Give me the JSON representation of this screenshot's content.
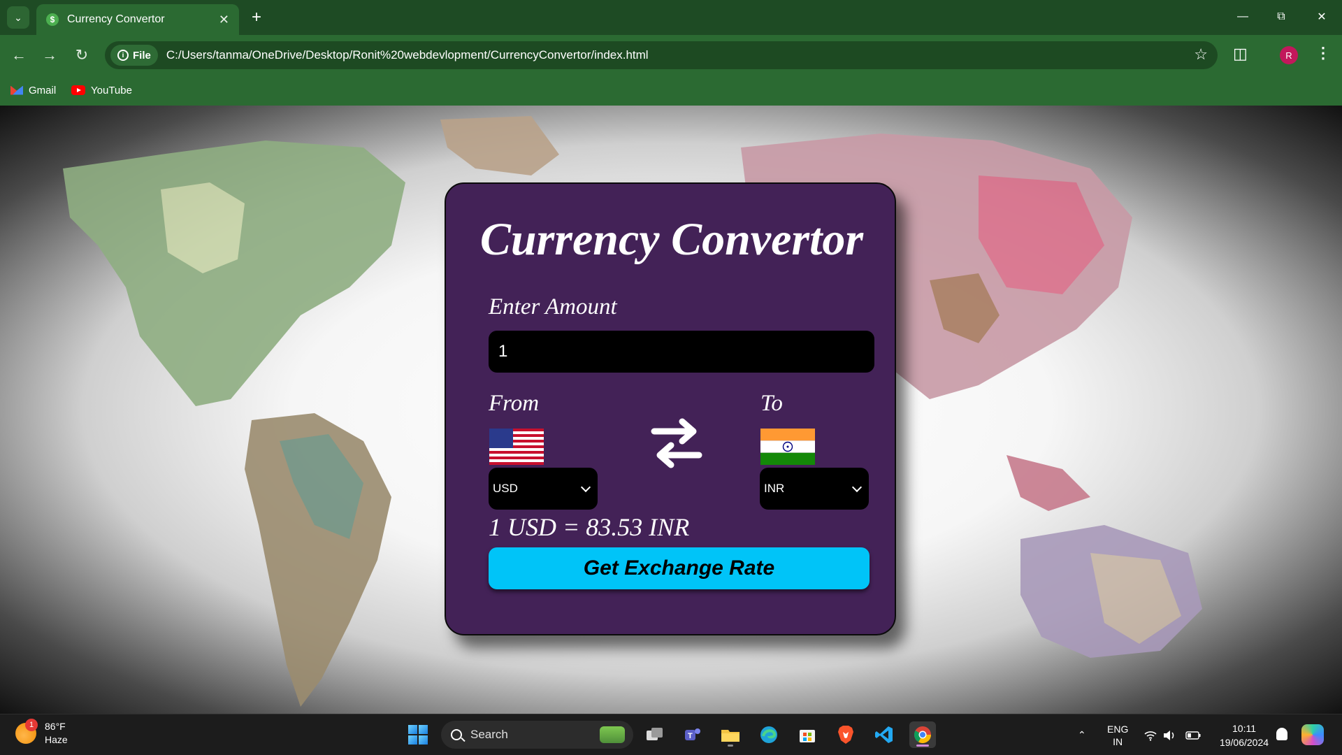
{
  "browser": {
    "tab_title": "Currency Convertor",
    "site_chip": "File",
    "url": "C:/Users/tanma/OneDrive/Desktop/Ronit%20webdevlopment/CurrencyConvertor/index.html",
    "profile_initial": "R",
    "bookmarks": [
      {
        "label": "Gmail",
        "icon": "gmail-icon"
      },
      {
        "label": "YouTube",
        "icon": "youtube-icon"
      }
    ],
    "theme_color": "#2b6a32"
  },
  "app": {
    "title": "Currency Convertor",
    "amount_label": "Enter Amount",
    "amount_value": "1",
    "from_label": "From",
    "to_label": "To",
    "from_currency": "USD",
    "to_currency": "INR",
    "from_flag": "us-flag-icon",
    "to_flag": "india-flag-icon",
    "result": "1 USD = 83.53 INR",
    "button_label": "Get Exchange Rate",
    "card_color": "#432257",
    "button_color": "#00c4f8"
  },
  "taskbar": {
    "weather_temp": "86°F",
    "weather_desc": "Haze",
    "weather_badge": "1",
    "search_placeholder": "Search",
    "language_top": "ENG",
    "language_bottom": "IN",
    "time": "10:11",
    "date": "19/06/2024"
  }
}
